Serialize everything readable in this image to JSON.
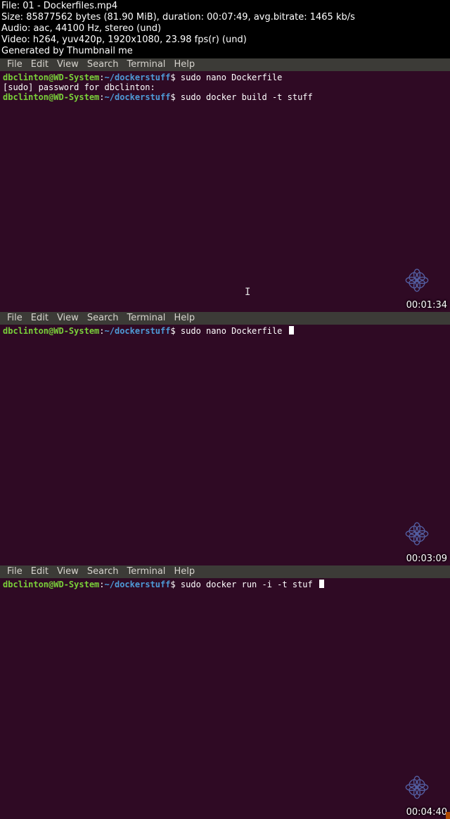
{
  "header": {
    "file_line": "File: 01 - Dockerfiles.mp4",
    "size_line": "Size: 85877562 bytes (81.90 MiB), duration: 00:07:49, avg.bitrate: 1465 kb/s",
    "audio_line": "Audio: aac, 44100 Hz, stereo (und)",
    "video_line": "Video: h264, yuv420p, 1920x1080, 23.98 fps(r) (und)",
    "generated_line": "Generated by Thumbnail me"
  },
  "menus": {
    "file": "File",
    "edit": "Edit",
    "view": "View",
    "search": "Search",
    "terminal": "Terminal",
    "help": "Help"
  },
  "prompt": {
    "user_host": "dbclinton@WD-System",
    "colon": ":",
    "path": "~/dockerstuff",
    "dollar": "$"
  },
  "frames": [
    {
      "timestamp": "00:01:34",
      "lines": [
        {
          "type": "cmd",
          "text": "sudo nano Dockerfile"
        },
        {
          "type": "plain",
          "text": "[sudo] password for dbclinton:"
        },
        {
          "type": "cmd",
          "text": "sudo docker build -t stuff"
        }
      ],
      "show_big_text_cursor": true,
      "show_block_cursor": false
    },
    {
      "timestamp": "00:03:09",
      "lines": [
        {
          "type": "cmd",
          "text": "sudo nano Dockerfile"
        }
      ],
      "show_big_text_cursor": false,
      "show_block_cursor": true
    },
    {
      "timestamp": "00:04:40",
      "lines": [
        {
          "type": "cmd",
          "text": "sudo docker run -i -t stuf"
        }
      ],
      "show_big_text_cursor": false,
      "show_block_cursor": true
    }
  ]
}
